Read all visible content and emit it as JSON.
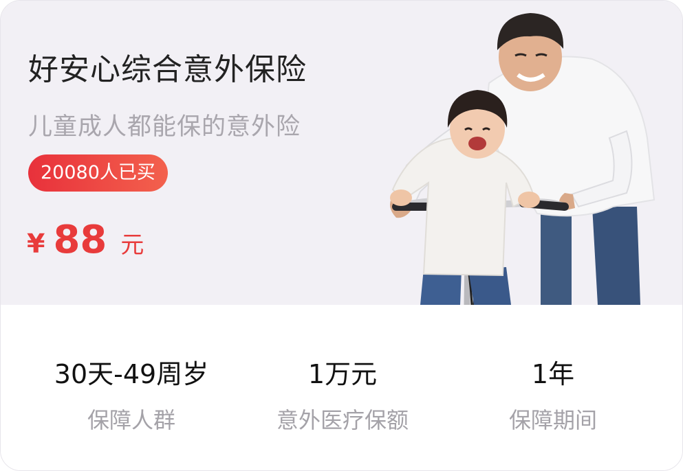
{
  "product": {
    "title": "好安心综合意外保险",
    "subtitle": "儿童成人都能保的意外险",
    "purchased_badge": "20080人已买",
    "price": {
      "currency": "¥",
      "amount": "88",
      "unit": "元"
    }
  },
  "stats": [
    {
      "value": "30天-49周岁",
      "label": "保障人群"
    },
    {
      "value": "1万元",
      "label": "意外医疗保额"
    },
    {
      "value": "1年",
      "label": "保障期间"
    }
  ],
  "colors": {
    "accent": "#e83b3b",
    "hero_bg": "#f2f0f5",
    "muted_text": "#a4a2a8"
  }
}
